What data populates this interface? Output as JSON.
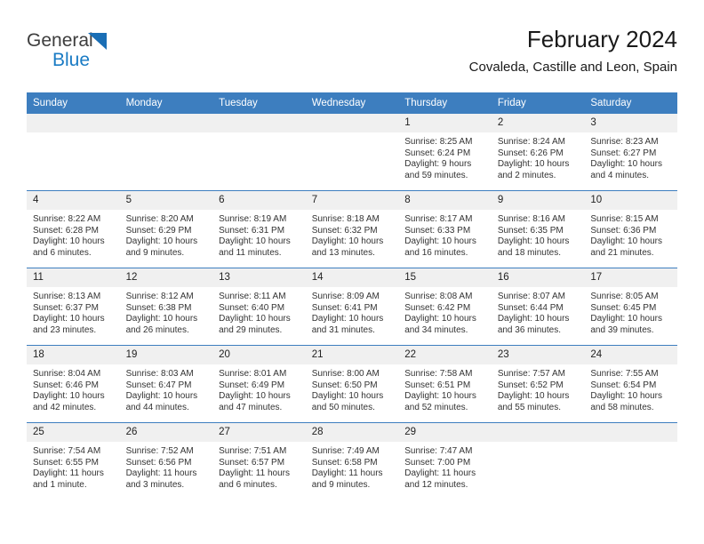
{
  "brand": {
    "name_top": "General",
    "name_bottom": "Blue",
    "triangle_icon": "triangle-icon",
    "color_dark": "#3d3d3d",
    "color_blue": "#1a7bc4"
  },
  "header": {
    "title": "February 2024",
    "subtitle": "Covaleda, Castille and Leon, Spain"
  },
  "theme": {
    "header_blue": "#3d7ebf",
    "daynum_gray": "#f0f0f0",
    "text": "#333333"
  },
  "calendar": {
    "weekday_headers": [
      "Sunday",
      "Monday",
      "Tuesday",
      "Wednesday",
      "Thursday",
      "Friday",
      "Saturday"
    ],
    "weeks": [
      [
        {
          "day": "",
          "empty": true
        },
        {
          "day": "",
          "empty": true
        },
        {
          "day": "",
          "empty": true
        },
        {
          "day": "",
          "empty": true
        },
        {
          "day": "1",
          "sunrise": "Sunrise: 8:25 AM",
          "sunset": "Sunset: 6:24 PM",
          "daylight": "Daylight: 9 hours and 59 minutes."
        },
        {
          "day": "2",
          "sunrise": "Sunrise: 8:24 AM",
          "sunset": "Sunset: 6:26 PM",
          "daylight": "Daylight: 10 hours and 2 minutes."
        },
        {
          "day": "3",
          "sunrise": "Sunrise: 8:23 AM",
          "sunset": "Sunset: 6:27 PM",
          "daylight": "Daylight: 10 hours and 4 minutes."
        }
      ],
      [
        {
          "day": "4",
          "sunrise": "Sunrise: 8:22 AM",
          "sunset": "Sunset: 6:28 PM",
          "daylight": "Daylight: 10 hours and 6 minutes."
        },
        {
          "day": "5",
          "sunrise": "Sunrise: 8:20 AM",
          "sunset": "Sunset: 6:29 PM",
          "daylight": "Daylight: 10 hours and 9 minutes."
        },
        {
          "day": "6",
          "sunrise": "Sunrise: 8:19 AM",
          "sunset": "Sunset: 6:31 PM",
          "daylight": "Daylight: 10 hours and 11 minutes."
        },
        {
          "day": "7",
          "sunrise": "Sunrise: 8:18 AM",
          "sunset": "Sunset: 6:32 PM",
          "daylight": "Daylight: 10 hours and 13 minutes."
        },
        {
          "day": "8",
          "sunrise": "Sunrise: 8:17 AM",
          "sunset": "Sunset: 6:33 PM",
          "daylight": "Daylight: 10 hours and 16 minutes."
        },
        {
          "day": "9",
          "sunrise": "Sunrise: 8:16 AM",
          "sunset": "Sunset: 6:35 PM",
          "daylight": "Daylight: 10 hours and 18 minutes."
        },
        {
          "day": "10",
          "sunrise": "Sunrise: 8:15 AM",
          "sunset": "Sunset: 6:36 PM",
          "daylight": "Daylight: 10 hours and 21 minutes."
        }
      ],
      [
        {
          "day": "11",
          "sunrise": "Sunrise: 8:13 AM",
          "sunset": "Sunset: 6:37 PM",
          "daylight": "Daylight: 10 hours and 23 minutes."
        },
        {
          "day": "12",
          "sunrise": "Sunrise: 8:12 AM",
          "sunset": "Sunset: 6:38 PM",
          "daylight": "Daylight: 10 hours and 26 minutes."
        },
        {
          "day": "13",
          "sunrise": "Sunrise: 8:11 AM",
          "sunset": "Sunset: 6:40 PM",
          "daylight": "Daylight: 10 hours and 29 minutes."
        },
        {
          "day": "14",
          "sunrise": "Sunrise: 8:09 AM",
          "sunset": "Sunset: 6:41 PM",
          "daylight": "Daylight: 10 hours and 31 minutes."
        },
        {
          "day": "15",
          "sunrise": "Sunrise: 8:08 AM",
          "sunset": "Sunset: 6:42 PM",
          "daylight": "Daylight: 10 hours and 34 minutes."
        },
        {
          "day": "16",
          "sunrise": "Sunrise: 8:07 AM",
          "sunset": "Sunset: 6:44 PM",
          "daylight": "Daylight: 10 hours and 36 minutes."
        },
        {
          "day": "17",
          "sunrise": "Sunrise: 8:05 AM",
          "sunset": "Sunset: 6:45 PM",
          "daylight": "Daylight: 10 hours and 39 minutes."
        }
      ],
      [
        {
          "day": "18",
          "sunrise": "Sunrise: 8:04 AM",
          "sunset": "Sunset: 6:46 PM",
          "daylight": "Daylight: 10 hours and 42 minutes."
        },
        {
          "day": "19",
          "sunrise": "Sunrise: 8:03 AM",
          "sunset": "Sunset: 6:47 PM",
          "daylight": "Daylight: 10 hours and 44 minutes."
        },
        {
          "day": "20",
          "sunrise": "Sunrise: 8:01 AM",
          "sunset": "Sunset: 6:49 PM",
          "daylight": "Daylight: 10 hours and 47 minutes."
        },
        {
          "day": "21",
          "sunrise": "Sunrise: 8:00 AM",
          "sunset": "Sunset: 6:50 PM",
          "daylight": "Daylight: 10 hours and 50 minutes."
        },
        {
          "day": "22",
          "sunrise": "Sunrise: 7:58 AM",
          "sunset": "Sunset: 6:51 PM",
          "daylight": "Daylight: 10 hours and 52 minutes."
        },
        {
          "day": "23",
          "sunrise": "Sunrise: 7:57 AM",
          "sunset": "Sunset: 6:52 PM",
          "daylight": "Daylight: 10 hours and 55 minutes."
        },
        {
          "day": "24",
          "sunrise": "Sunrise: 7:55 AM",
          "sunset": "Sunset: 6:54 PM",
          "daylight": "Daylight: 10 hours and 58 minutes."
        }
      ],
      [
        {
          "day": "25",
          "sunrise": "Sunrise: 7:54 AM",
          "sunset": "Sunset: 6:55 PM",
          "daylight": "Daylight: 11 hours and 1 minute."
        },
        {
          "day": "26",
          "sunrise": "Sunrise: 7:52 AM",
          "sunset": "Sunset: 6:56 PM",
          "daylight": "Daylight: 11 hours and 3 minutes."
        },
        {
          "day": "27",
          "sunrise": "Sunrise: 7:51 AM",
          "sunset": "Sunset: 6:57 PM",
          "daylight": "Daylight: 11 hours and 6 minutes."
        },
        {
          "day": "28",
          "sunrise": "Sunrise: 7:49 AM",
          "sunset": "Sunset: 6:58 PM",
          "daylight": "Daylight: 11 hours and 9 minutes."
        },
        {
          "day": "29",
          "sunrise": "Sunrise: 7:47 AM",
          "sunset": "Sunset: 7:00 PM",
          "daylight": "Daylight: 11 hours and 12 minutes."
        },
        {
          "day": "",
          "empty": true
        },
        {
          "day": "",
          "empty": true
        }
      ]
    ]
  }
}
